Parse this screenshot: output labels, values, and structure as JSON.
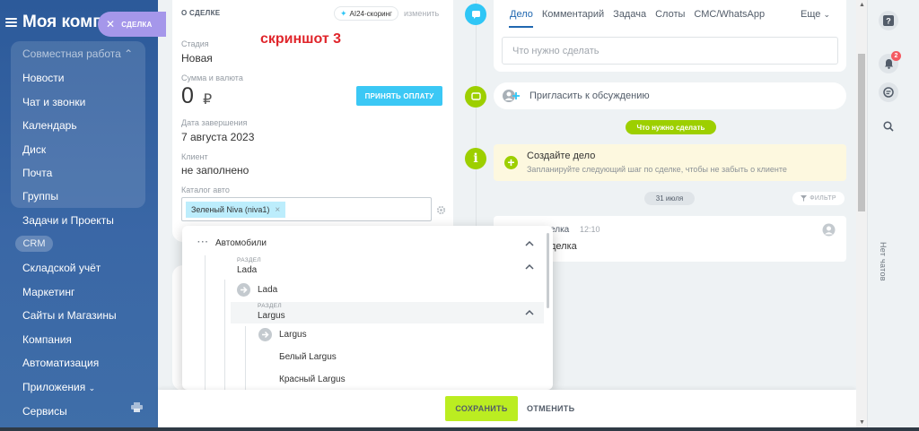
{
  "sidebar": {
    "title": "Моя компания",
    "group_label": "Совместная работа",
    "items": [
      "Новости",
      "Чат и звонки",
      "Календарь",
      "Диск",
      "Почта",
      "Группы",
      "Задачи и Проекты"
    ],
    "crm_label": "CRM",
    "items2": [
      "Складской учёт",
      "Маркетинг",
      "Сайты и Магазины",
      "Компания",
      "Автоматизация",
      "Приложения",
      "Сервисы"
    ]
  },
  "deal_tab": {
    "label": "СДЕЛКА"
  },
  "deal": {
    "section_title": "О СДЕЛКЕ",
    "ai_badge": "AI24-скоринг",
    "edit_label": "изменить",
    "stage_label": "Стадия",
    "stage_value": "Новая",
    "sum_label": "Сумма и валюта",
    "sum_value": "0",
    "currency": "₽",
    "pay_button": "ПРИНЯТЬ ОПЛАТУ",
    "close_date_label": "Дата завершения",
    "close_date_value": "7 августа 2023",
    "client_label": "Клиент",
    "client_value": "не заполнено",
    "catalog_label": "Каталог авто",
    "catalog_tag": "Зеленый Niva (niva1)",
    "note": "скриншот 3"
  },
  "dropdown": {
    "root": "Автомобили",
    "section_label": "РАЗДЕЛ",
    "lada_section": "Lada",
    "lada_item": "Lada",
    "largus_section": "Largus",
    "largus_item": "Largus",
    "white_largus": "Белый Largus",
    "red_largus": "Красный Largus"
  },
  "timeline": {
    "tabs": [
      "Дело",
      "Комментарий",
      "Задача",
      "Слоты",
      "СМС/WhatsApp"
    ],
    "more": "Еще",
    "input_placeholder": "Что нужно сделать",
    "invite": "Пригласить к обсуждению",
    "todo_pill": "Что нужно сделать",
    "create_title": "Создайте дело",
    "create_sub": "Запланируйте следующий шаг по сделке, чтобы не забыть о клиенте",
    "date_pill": "31 июля",
    "filter": "ФИЛЬТР",
    "history_title": "елка",
    "history_time": "12:10",
    "history_body": "делка"
  },
  "footer": {
    "save": "СОХРАНИТЬ",
    "cancel": "ОТМЕНИТЬ"
  },
  "chat_panel": {
    "badge": "2",
    "no_chats": "Нет чатов"
  },
  "colors": {
    "accent_green": "#bbed21",
    "pay_blue": "#3bc8f5",
    "note_red": "#e0252b",
    "deal_tab": "#a597ea"
  }
}
